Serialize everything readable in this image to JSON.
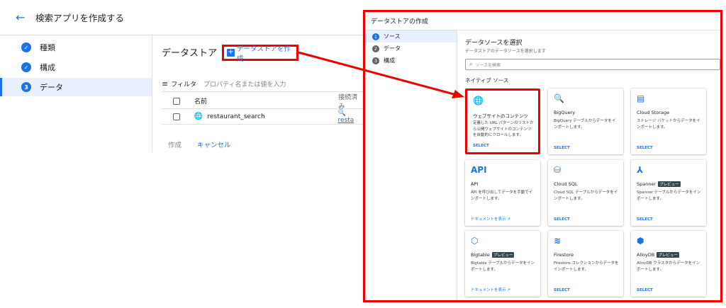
{
  "header": {
    "back_icon": "arrow-left-icon",
    "title": "検索アプリを作成する"
  },
  "stepper": {
    "steps": [
      {
        "label": "種類",
        "state": "done",
        "icon": "check-icon"
      },
      {
        "label": "構成",
        "state": "done",
        "icon": "check-icon"
      },
      {
        "label": "データ",
        "state": "active",
        "number": "3"
      }
    ]
  },
  "datastore": {
    "title": "データストア",
    "create_label": "データストアを作成",
    "filter_label": "フィルタ",
    "filter_placeholder": "プロパティ名または値を入力",
    "col_name": "名前",
    "col_conn": "接続済み",
    "rows": [
      {
        "name": "restaurant_search",
        "conn": "resta"
      }
    ]
  },
  "actions": {
    "create": "作成",
    "cancel": "キャンセル"
  },
  "dialog": {
    "title": "データストアの作成",
    "steps": [
      {
        "number": "1",
        "label": "ソース"
      },
      {
        "number": "2",
        "label": "データ"
      },
      {
        "number": "3",
        "label": "構成"
      }
    ],
    "select_title": "データソースを選択",
    "select_subtitle": "データストアのデータソースを選択します",
    "search_placeholder": "ソースを検索",
    "native_label": "ネイティブ ソース",
    "cards": [
      {
        "icon": "globe-icon",
        "glyph": "🌐",
        "name": "ウェブサイトのコンテンツ",
        "badge": "",
        "desc": "定義した URL パターンのリストから公開ウェブサイトのコンテンツを自動的にクロールします。",
        "action": "SELECT"
      },
      {
        "icon": "bigquery-icon",
        "glyph": "🔍",
        "name": "BigQuery",
        "badge": "",
        "desc": "BigQuery テーブルからデータをインポートします。",
        "action": "SELECT"
      },
      {
        "icon": "cloud-storage-icon",
        "glyph": "▤",
        "name": "Cloud Storage",
        "badge": "",
        "desc": "ストレージ バケットからデータをインポートします。",
        "action": "SELECT"
      },
      {
        "icon": "api-icon",
        "glyph": "API",
        "name": "API",
        "badge": "",
        "desc": "API を呼び出してデータを手動でインポートします。",
        "action": "ドキュメントを表示 ↗"
      },
      {
        "icon": "cloud-sql-icon",
        "glyph": "⛁",
        "name": "Cloud SQL",
        "badge": "",
        "desc": "Cloud SQL テーブルからデータをインポートします。",
        "action": "SELECT"
      },
      {
        "icon": "spanner-icon",
        "glyph": "⅄",
        "name": "Spanner",
        "badge": "プレビュー",
        "desc": "Spanner テーブルからデータをインポートします。",
        "action": "SELECT"
      },
      {
        "icon": "bigtable-icon",
        "glyph": "⬡",
        "name": "Bigtable",
        "badge": "プレビュー",
        "desc": "Bigtable テーブルからデータをインポートします。",
        "action": "ドキュメントを表示 ↗"
      },
      {
        "icon": "firestore-icon",
        "glyph": "≋",
        "name": "Firestore",
        "badge": "",
        "desc": "Firestore コレクションからデータをインポートします。",
        "action": "SELECT"
      },
      {
        "icon": "alloydb-icon",
        "glyph": "⬢",
        "name": "AlloyDB",
        "badge": "プレビュー",
        "desc": "AlloyDB クラスタからデータをインポートします。",
        "action": "SELECT"
      }
    ]
  },
  "colors": {
    "accent": "#1a73e8",
    "highlight": "#ee0000"
  }
}
